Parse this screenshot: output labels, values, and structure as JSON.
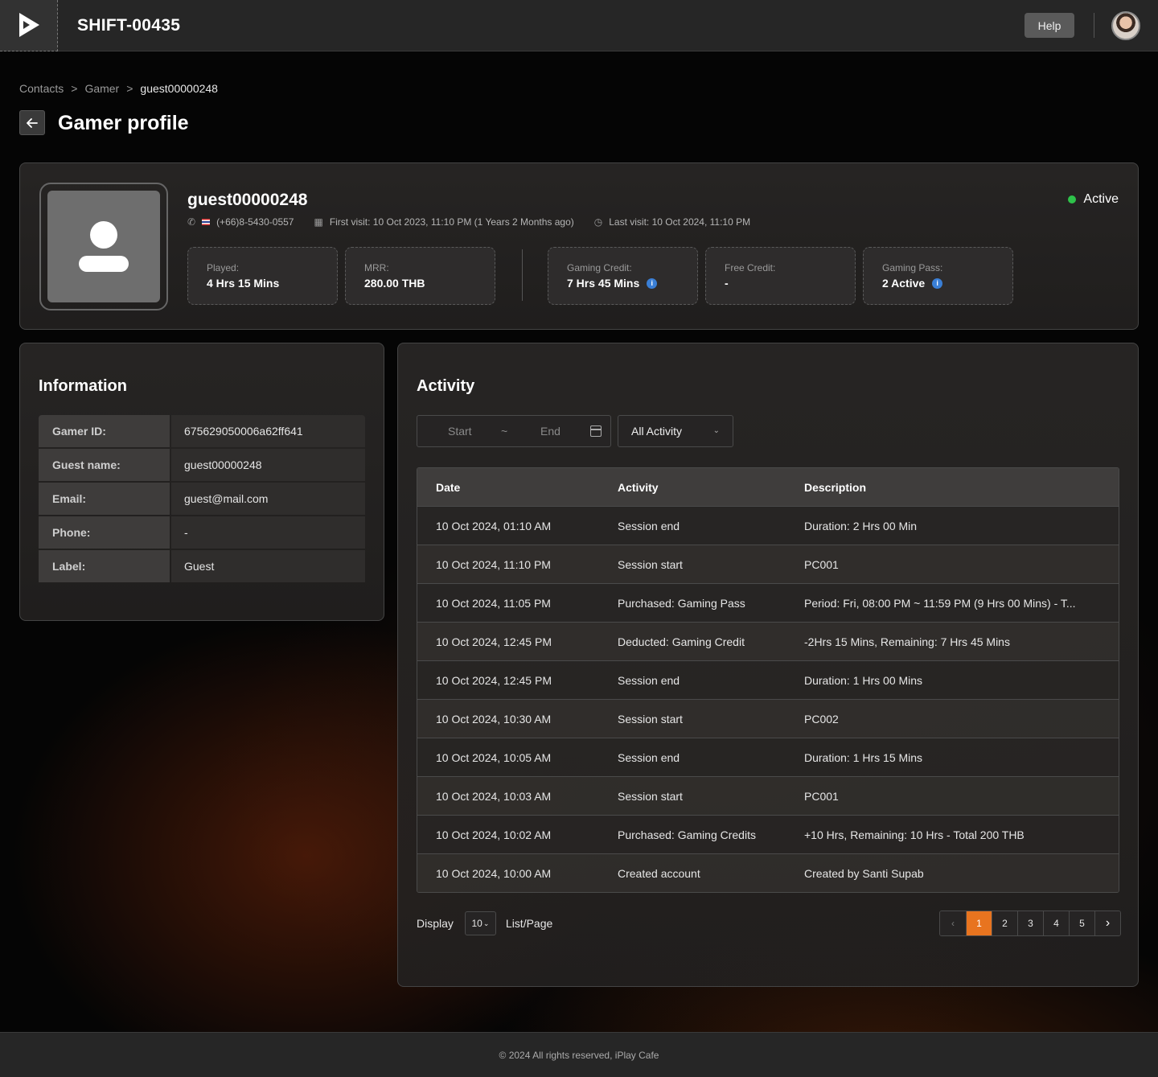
{
  "header": {
    "shift_id": "SHIFT-00435",
    "help_label": "Help"
  },
  "breadcrumb": [
    "Contacts",
    "Gamer",
    "guest00000248"
  ],
  "page_title": "Gamer profile",
  "profile": {
    "name": "guest00000248",
    "status": "Active",
    "phone": "(+66)8-5430-0557",
    "first_visit": "First visit: 10 Oct 2023, 11:10 PM (1 Years 2 Months ago)",
    "last_visit": "Last visit: 10 Oct 2024, 11:10 PM",
    "stats": [
      {
        "label": "Played:",
        "value": "4 Hrs 15 Mins"
      },
      {
        "label": "MRR:",
        "value": "280.00 THB"
      },
      {
        "label": "Gaming Credit:",
        "value": "7 Hrs 45 Mins"
      },
      {
        "label": "Free Credit:",
        "value": "-"
      },
      {
        "label": "Gaming Pass:",
        "value": "2 Active"
      }
    ]
  },
  "information": {
    "title": "Information",
    "rows": [
      {
        "label": "Gamer ID:",
        "value": "675629050006a62ff641"
      },
      {
        "label": "Guest name:",
        "value": "guest00000248"
      },
      {
        "label": "Email:",
        "value": "guest@mail.com"
      },
      {
        "label": "Phone:",
        "value": "-"
      },
      {
        "label": "Label:",
        "value": "Guest"
      }
    ]
  },
  "activity": {
    "title": "Activity",
    "date_start_placeholder": "Start",
    "date_sep": "~",
    "date_end_placeholder": "End",
    "filter_value": "All Activity",
    "columns": [
      "Date",
      "Activity",
      "Description"
    ],
    "rows": [
      [
        "10 Oct 2024, 01:10 AM",
        "Session end",
        "Duration: 2 Hrs 00 Min"
      ],
      [
        "10 Oct 2024, 11:10 PM",
        "Session start",
        "PC001"
      ],
      [
        "10 Oct 2024, 11:05 PM",
        "Purchased: Gaming Pass",
        "Period: Fri, 08:00 PM ~ 11:59 PM (9 Hrs 00 Mins) - T..."
      ],
      [
        "10 Oct 2024, 12:45 PM",
        "Deducted: Gaming Credit",
        "-2Hrs 15 Mins,  Remaining: 7 Hrs 45 Mins"
      ],
      [
        "10 Oct 2024, 12:45 PM",
        "Session end",
        "Duration: 1 Hrs 00 Mins"
      ],
      [
        "10 Oct 2024, 10:30 AM",
        "Session start",
        "PC002"
      ],
      [
        "10 Oct 2024, 10:05 AM",
        "Session end",
        "Duration: 1 Hrs 15 Mins"
      ],
      [
        "10 Oct 2024, 10:03 AM",
        "Session start",
        "PC001"
      ],
      [
        "10 Oct 2024, 10:02 AM",
        "Purchased: Gaming Credits",
        "+10 Hrs, Remaining:  10 Hrs - Total 200 THB"
      ],
      [
        "10 Oct 2024, 10:00 AM",
        "Created account",
        "Created by Santi Supab"
      ]
    ],
    "pagination": {
      "display_label": "Display",
      "per_page": "10",
      "list_page_label": "List/Page",
      "pages": [
        "1",
        "2",
        "3",
        "4",
        "5"
      ],
      "current_page": "1"
    }
  },
  "footer": {
    "text": "© 2024 All rights reserved, iPlay Cafe"
  },
  "colors": {
    "accent": "#e8741f",
    "status_active": "#2ec24a",
    "info_icon": "#3a7fd6"
  }
}
